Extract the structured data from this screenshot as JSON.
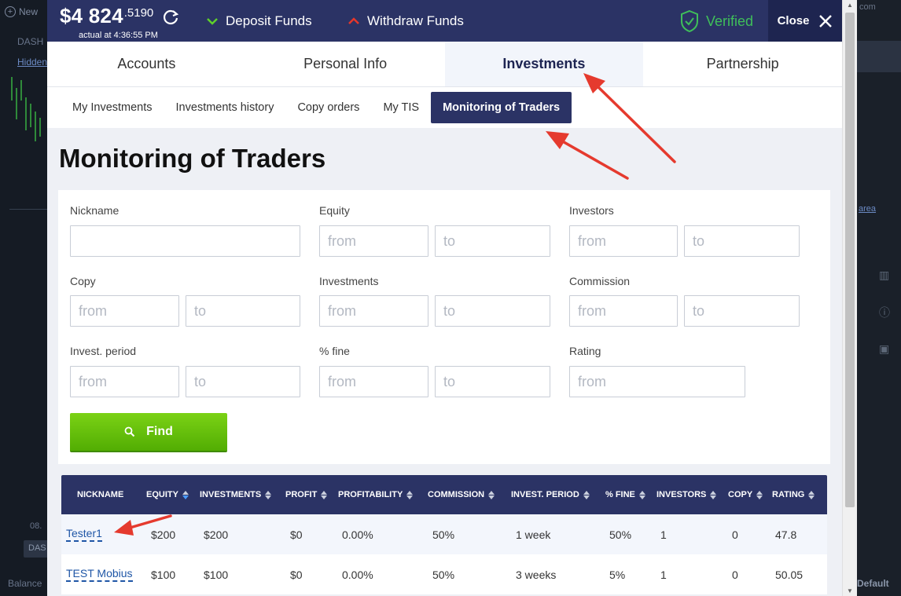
{
  "background": {
    "new_label": "New",
    "dash_label": "DASH",
    "hidden_label": "Hidden",
    "time_label": "08.",
    "dash_button": "DAS",
    "balance_label": "Balance",
    "com_label": "com",
    "area_label": "area",
    "default_label": "Default"
  },
  "topbar": {
    "balance_main": "$4 824",
    "balance_decimals": ".5190",
    "balance_actual": "actual at 4:36:55 PM",
    "deposit_label": "Deposit Funds",
    "withdraw_label": "Withdraw Funds",
    "verified_label": "Verified",
    "close_label": "Close"
  },
  "main_tabs": [
    "Accounts",
    "Personal Info",
    "Investments",
    "Partnership"
  ],
  "sub_tabs": [
    "My Investments",
    "Investments history",
    "Copy orders",
    "My TIS",
    "Monitoring of Traders"
  ],
  "page": {
    "title": "Monitoring of Traders"
  },
  "filters": {
    "nickname_label": "Nickname",
    "equity_label": "Equity",
    "investors_label": "Investors",
    "copy_label": "Copy",
    "investments_label": "Investments",
    "commission_label": "Commission",
    "invest_period_label": "Invest. period",
    "fine_label": "% fine",
    "rating_label": "Rating",
    "from_placeholder": "from",
    "to_placeholder": "to",
    "find_label": "Find"
  },
  "table": {
    "headers": [
      "NICKNAME",
      "EQUITY",
      "INVESTMENTS",
      "PROFIT",
      "PROFITABILITY",
      "COMMISSION",
      "INVEST. PERIOD",
      "% FINE",
      "INVESTORS",
      "COPY",
      "RATING"
    ],
    "rows": [
      [
        "Tester1",
        "$200",
        "$200",
        "$0",
        "0.00%",
        "50%",
        "1 week",
        "50%",
        "1",
        "0",
        "47.8"
      ],
      [
        "TEST Mobius",
        "$100",
        "$100",
        "$0",
        "0.00%",
        "50%",
        "3 weeks",
        "5%",
        "1",
        "0",
        "50.05"
      ]
    ]
  },
  "colors": {
    "header_navy": "#2b3365",
    "find_green": "#62bd0a",
    "verified_green": "#3fbf5a",
    "annotation_red": "#e53a2e"
  }
}
